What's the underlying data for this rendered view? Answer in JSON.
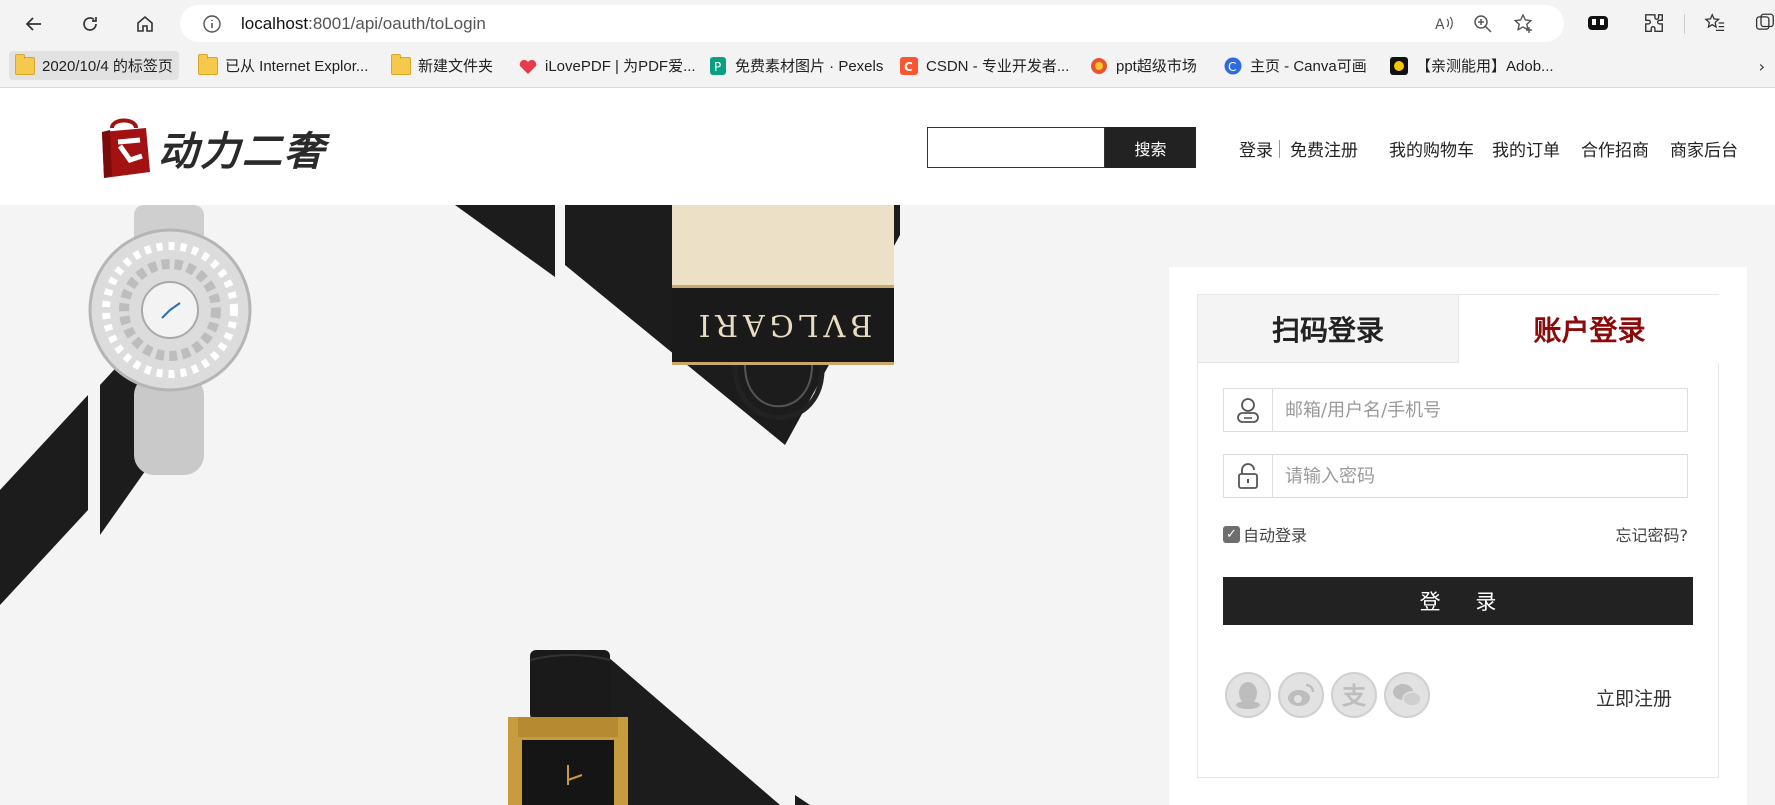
{
  "browser": {
    "url_host": "localhost",
    "url_rest": ":8001/api/oauth/toLogin",
    "bookmarks": [
      {
        "label": "2020/10/4 的标签页",
        "icon": "folder-icon"
      },
      {
        "label": "已从 Internet Explor...",
        "icon": "folder-icon"
      },
      {
        "label": "新建文件夹",
        "icon": "folder-icon"
      },
      {
        "label": "iLovePDF | 为PDF爱...",
        "icon": "heart-icon"
      },
      {
        "label": "免费素材图片 · Pexels",
        "icon": "pexels-icon"
      },
      {
        "label": "CSDN - 专业开发者...",
        "icon": "csdn-icon"
      },
      {
        "label": "ppt超级市场",
        "icon": "ppt-icon"
      },
      {
        "label": "主页 - Canva可画",
        "icon": "canva-icon"
      },
      {
        "label": "【亲测能用】Adob...",
        "icon": "adobe-icon"
      }
    ]
  },
  "header": {
    "logo_text": "动力二奢",
    "search_button": "搜索",
    "links": {
      "login": "登录",
      "register": "免费注册",
      "cart": "我的购物车",
      "orders": "我的订单",
      "partner": "合作招商",
      "merchant": "商家后台"
    }
  },
  "login": {
    "tab_qr": "扫码登录",
    "tab_account": "账户登录",
    "username_placeholder": "邮箱/用户名/手机号",
    "password_placeholder": "请输入密码",
    "auto_login": "自动登录",
    "forgot": "忘记密码?",
    "submit": "登 录",
    "register_now": "立即注册",
    "social": [
      "qq-icon",
      "weibo-icon",
      "alipay-icon",
      "wechat-icon"
    ]
  },
  "art": {
    "bag_brand": "BVLGARI"
  },
  "colors": {
    "accent_red": "#8b0a0a",
    "dark": "#222222",
    "panel_bg": "#f4f4f4"
  }
}
